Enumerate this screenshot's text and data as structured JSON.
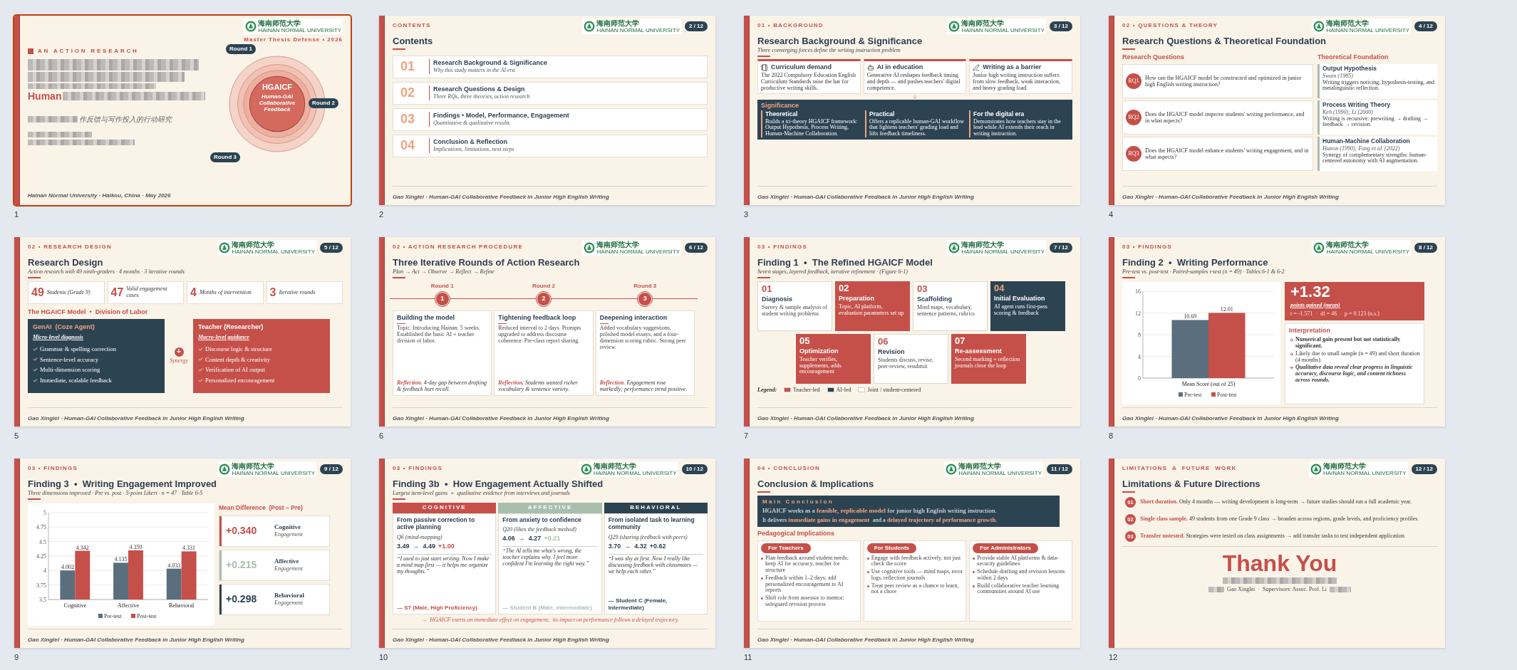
{
  "slides": [
    {
      "number": "1",
      "selected": true,
      "kind": "title",
      "logo": {
        "zh": "海南师范大学",
        "en": "HAINAN NORMAL UNIVERSITY"
      },
      "tagline": "Master Thesis Defense • 2026",
      "eyebrow": "AN ACTION RESEARCH",
      "title_visible": "Human",
      "subtitle_visible": "作反馈与写作投入的行动研究",
      "footer": "Hainan Normal University · Haikou, China · May 2026",
      "diagram": {
        "center": "HGAICF",
        "center_sub": "Human-GAI Collaborative Feedback",
        "rounds": [
          "Round 1",
          "Round 2",
          "Round 3"
        ]
      }
    },
    {
      "number": "2",
      "selected": false,
      "kind": "contents",
      "section": "CONTENTS",
      "page": "2 / 12",
      "logo": {
        "zh": "海南师范大学",
        "en": "HAINAN NORMAL UNIVERSITY"
      },
      "title": "Contents",
      "footer": "Gao Xinglei · Human-GAI Collaborative Feedback in Junior High English Writing",
      "items": [
        {
          "num": "01",
          "title": "Research Background & Significance",
          "sub": "Why this study matters in the AI era"
        },
        {
          "num": "02",
          "title": "Research Questions & Design",
          "sub": "Three RQs, three theories, action research"
        },
        {
          "num": "03",
          "title": "Findings • Model, Performance, Engagement",
          "sub": "Quantitative & qualitative results"
        },
        {
          "num": "04",
          "title": "Conclusion & Reflection",
          "sub": "Implications, limitations, next steps"
        }
      ]
    },
    {
      "number": "3",
      "selected": false,
      "kind": "background",
      "section": "01 • BACKGROUND",
      "page": "3 / 12",
      "logo": {
        "zh": "海南师范大学",
        "en": "HAINAN NORMAL UNIVERSITY"
      },
      "title": "Research Background & Significance",
      "subtitle": "Three converging forces define the writing instruction problem",
      "footer": "Gao Xinglei · Human-GAI Collaborative Feedback in Junior High English Writing",
      "cards": [
        {
          "title": "Curriculum demand",
          "text": "The 2022 Compulsory Education English Curriculum Standards raise the bar for productive writing skills."
        },
        {
          "title": "AI in education",
          "text": "Generative AI reshapes feedback timing and depth — and pushes teachers' digital competence."
        },
        {
          "title": "Writing as a barrier",
          "text": "Junior high writing instruction suffers from slow feedback, weak interaction, and heavy grading load."
        }
      ],
      "significance": {
        "heading": "Significance",
        "columns": [
          {
            "title": "Theoretical",
            "text": "Builds a tri-theory HGAICF framework: Output Hypothesis, Process Writing, Human-Machine Collaboration."
          },
          {
            "title": "Practical",
            "text": "Offers a replicable human-GAI workflow that lightens teachers' grading load and lifts feedback timeliness."
          },
          {
            "title": "For the digital era",
            "text": "Demonstrates how teachers stay in the lead while AI extends their reach in writing instruction."
          }
        ]
      }
    },
    {
      "number": "4",
      "selected": false,
      "kind": "questions",
      "section": "02 • QUESTIONS & THEORY",
      "page": "4 / 12",
      "logo": {
        "zh": "海南师范大学",
        "en": "HAINAN NORMAL UNIVERSITY"
      },
      "title": "Research Questions & Theoretical Foundation",
      "footer": "Gao Xinglei · Human-GAI Collaborative Feedback in Junior High English Writing",
      "rq_heading": "Research Questions",
      "theory_heading": "Theoretical Foundation",
      "questions": [
        {
          "badge": "RQ1",
          "text": "How can the HGAICF model be constructed and optimized in junior high English writing instruction?"
        },
        {
          "badge": "RQ2",
          "text": "Does the HGAICF model improve students' writing performance, and in what aspects?"
        },
        {
          "badge": "RQ3",
          "text": "Does the HGAICF model enhance students' writing engagement, and in what aspects?"
        }
      ],
      "theories": [
        {
          "title": "Output Hypothesis",
          "cite": "Swain (1985)",
          "text": "Writing triggers noticing, hypothesis-testing, and metalinguistic reflection."
        },
        {
          "title": "Process Writing Theory",
          "cite": "Keh (1990); Li (2000)",
          "text": "Writing is recursive: prewriting → drafting → feedback → revision."
        },
        {
          "title": "Human-Machine Collaboration",
          "cite": "Hutton (1990); Fang et al. (2022)",
          "text": "Synergy of complementary strengths: human-centered autonomy with AI augmentation."
        }
      ]
    },
    {
      "number": "5",
      "selected": false,
      "kind": "design",
      "section": "02 • RESEARCH DESIGN",
      "page": "5 / 12",
      "logo": {
        "zh": "海南师范大学",
        "en": "HAINAN NORMAL UNIVERSITY"
      },
      "title": "Research Design",
      "subtitle": "Action research with 49 ninth-graders · 4 months · 3 iterative rounds",
      "footer": "Gao Xinglei · Human-GAI Collaborative Feedback in Junior High English Writing",
      "stats": [
        {
          "value": "49",
          "label": "Students (Grade 9)"
        },
        {
          "value": "47",
          "label": "Valid engagement cases"
        },
        {
          "value": "4",
          "label": "Months of intervention"
        },
        {
          "value": "3",
          "label": "Iterative rounds"
        }
      ],
      "model_heading": "The HGAICF Model  •  Division of Labor",
      "synergy": {
        "symbol": "+",
        "label": "Synergy"
      },
      "panels": [
        {
          "kind": "ai",
          "title": "GenAI  (Coze Agent)",
          "sub": "Micro-level diagnosis",
          "items": [
            "Grammar & spelling correction",
            "Sentence-level accuracy",
            "Multi-dimension scoring",
            "Immediate, scalable feedback"
          ]
        },
        {
          "kind": "teacher",
          "title": "Teacher (Researcher)",
          "sub": "Macro-level guidance",
          "items": [
            "Discourse logic & structure",
            "Content depth & creativity",
            "Verification of AI output",
            "Personalized encouragement"
          ]
        }
      ]
    },
    {
      "number": "6",
      "selected": false,
      "kind": "rounds",
      "section": "02 • ACTION RESEARCH PROCEDURE",
      "page": "6 / 12",
      "logo": {
        "zh": "海南师范大学",
        "en": "HAINAN NORMAL UNIVERSITY"
      },
      "title": "Three Iterative Rounds of Action Research",
      "subtitle": "Plan → Act → Observe → Reflect → Refine",
      "footer": "Gao Xinglei · Human-GAI Collaborative Feedback in Junior High English Writing",
      "rounds": [
        {
          "label": "Round 1",
          "num": "1",
          "title": "Building the model",
          "text": "Topic: Introducing Hainan. 5 weeks. Established the basic AI + teacher division of labor.",
          "reflection": "**Reflection.** 4-day gap between drafting & feedback hurt recall."
        },
        {
          "label": "Round 2",
          "num": "2",
          "title": "Tightening feedback loop",
          "text": "Reduced interval to 2 days. Prompts upgraded to address discourse coherence. Pre-class report sharing.",
          "reflection": "**Reflection.** Students wanted richer vocabulary & sentence variety."
        },
        {
          "label": "Round 3",
          "num": "3",
          "title": "Deepening interaction",
          "text": "Added vocabulary suggestions, polished model essays, and a four-dimension scoring rubric. Strong peer review.",
          "reflection": "**Reflection.** Engagement rose markedly; performance trend positive."
        }
      ]
    },
    {
      "number": "7",
      "selected": false,
      "kind": "stages",
      "section": "03 • FINDINGS",
      "page": "7 / 12",
      "logo": {
        "zh": "海南师范大学",
        "en": "HAINAN NORMAL UNIVERSITY"
      },
      "title": "Finding 1  •  The Refined HGAICF Model",
      "subtitle": "Seven stages, layered feedback, iterative refinement · (Figure 6-1)",
      "footer": "Gao Xinglei · Human-GAI Collaborative Feedback in Junior High English Writing",
      "stages": [
        {
          "kind": "joint",
          "num": "01",
          "title": "Diagnosis",
          "text": "Survey & sample analysis of student writing problems"
        },
        {
          "kind": "teacher",
          "num": "02",
          "title": "Preparation",
          "text": "Topic, AI platform, evaluation parameters set up"
        },
        {
          "kind": "joint",
          "num": "03",
          "title": "Scaffolding",
          "text": "Mind maps, vocabulary, sentence patterns, rubrics"
        },
        {
          "kind": "ai",
          "num": "04",
          "title": "Initial Evaluation",
          "text": "AI agent runs first-pass scoring & feedback"
        },
        {
          "kind": "teacher",
          "num": "05",
          "title": "Optimization",
          "text": "Teacher verifies, supplements, adds encouragement"
        },
        {
          "kind": "joint",
          "num": "06",
          "title": "Revision",
          "text": "Students discuss, revise, peer-review, resubmit"
        },
        {
          "kind": "teacher",
          "num": "07",
          "title": "Re-assessment",
          "text": "Second marking + reflection journals close the loop"
        }
      ],
      "legend_label": "Legend:",
      "legend": [
        {
          "label": "Teacher-led",
          "color": "#c5504a"
        },
        {
          "label": "AI-led",
          "color": "#2c4352"
        },
        {
          "label": "Joint / student-centered",
          "color": "#ffffff"
        }
      ]
    },
    {
      "number": "8",
      "selected": false,
      "kind": "performance",
      "section": "03 • FINDINGS",
      "page": "8 / 12",
      "logo": {
        "zh": "海南师范大学",
        "en": "HAINAN NORMAL UNIVERSITY"
      },
      "title": "Finding 2  •  Writing Performance",
      "subtitle": "Pre-test vs. post-test · Paired-samples t-test (n = 49) · Tables 6-1 & 6-2",
      "footer": "Gao Xinglei · Human-GAI Collaborative Feedback in Junior High English Writing",
      "chart_data": {
        "type": "bar",
        "categories": [
          "Mean Score (out of 25)"
        ],
        "series": [
          {
            "name": "Pre-test",
            "color": "#5a6e7d",
            "values": [
              10.69
            ]
          },
          {
            "name": "Post-test",
            "color": "#c5504a",
            "values": [
              12.01
            ]
          }
        ],
        "ylim": [
          0,
          16
        ],
        "yticks": [
          0,
          4,
          8,
          12,
          16
        ],
        "data_labels": true,
        "grid": true,
        "legend": "bottom"
      },
      "gain": {
        "value": "+1.32",
        "label": "points gained (mean)",
        "stats": "t = -1.571  ·  df = 46  ·  p = 0.123 (n.s.)"
      },
      "interpretation": {
        "heading": "Interpretation",
        "items": [
          {
            "kind": "bold",
            "text": "Numerical gain present but not statistically significant."
          },
          {
            "kind": "plain",
            "text": "Likely due to small sample (n = 49) and short duration (4 months)."
          },
          {
            "kind": "emphasis",
            "text": "Qualitative data reveal clear progress in linguistic accuracy, discourse logic, and content richness across rounds."
          }
        ]
      }
    },
    {
      "number": "9",
      "selected": false,
      "kind": "engagement",
      "section": "03 • FINDINGS",
      "page": "9 / 12",
      "logo": {
        "zh": "海南师范大学",
        "en": "HAINAN NORMAL UNIVERSITY"
      },
      "title": "Finding 3  •  Writing Engagement Improved",
      "subtitle": "Three dimensions improved · Pre vs. post · 5-point Likert · n = 47 · Table 6-5",
      "footer": "Gao Xinglei · Human-GAI Collaborative Feedback in Junior High English Writing",
      "chart_data": {
        "type": "bar",
        "categories": [
          "Cognitive",
          "Affective",
          "Behavioral"
        ],
        "series": [
          {
            "name": "Pre-test",
            "color": "#5a6e7d",
            "values": [
              4.002,
              4.135,
              4.033
            ]
          },
          {
            "name": "Post-test",
            "color": "#c5504a",
            "values": [
              4.342,
              4.35,
              4.331
            ]
          }
        ],
        "ylim": [
          3.5,
          5
        ],
        "yticks": [
          3.5,
          3.75,
          4,
          4.25,
          4.5,
          4.75,
          5
        ],
        "value_labels": [
          [
            "4.002",
            "4.135",
            "4.033"
          ],
          [
            "4.342",
            "4.350",
            "4.331"
          ]
        ],
        "grid": true,
        "legend": "bottom"
      },
      "diff_heading": "Mean Difference  (Post − Pre)",
      "diffs": [
        {
          "value": "+0.340",
          "label": "Cognitive",
          "sub": "Engagement",
          "color": "#c5504a"
        },
        {
          "value": "+0.215",
          "label": "Affective",
          "sub": "Engagement",
          "color": "#a8bfae"
        },
        {
          "value": "+0.298",
          "label": "Behavioral",
          "sub": "Engagement",
          "color": "#2c4352"
        }
      ]
    },
    {
      "number": "10",
      "selected": false,
      "kind": "shifts",
      "section": "03 • FINDINGS",
      "page": "10 / 12",
      "logo": {
        "zh": "海南师范大学",
        "en": "HAINAN NORMAL UNIVERSITY"
      },
      "title": "Finding 3b  •  How Engagement Actually Shifted",
      "subtitle": "Largest item-level gains  +  qualitative evidence from interviews and journals",
      "footer": "Gao Xinglei · Human-GAI Collaborative Feedback in Junior High English Writing",
      "columns": [
        {
          "header": "COGNITIVE",
          "color": "#c5504a",
          "title": "From passive correction to active planning",
          "item": "Q6 (mind-mapping)",
          "scores": "3.49  →  4.49",
          "delta": "+1.00",
          "quote": "“I used to just start writing. Now I make a mind map first — it helps me organize my thoughts.”",
          "source": "— S7 (Male, High Proficiency)"
        },
        {
          "header": "AFFECTIVE",
          "color": "#a8bfae",
          "title": "From anxiety to confidence",
          "item": "Q20 (likes the feedback method)",
          "scores": "4.06  →  4.27",
          "delta": "+0.21",
          "quote": "“The AI tells me what's wrong, the teacher explains why. I feel more confident I'm learning the right way.”",
          "source": "— Student B (Male, Intermediate)"
        },
        {
          "header": "BEHAVIORAL",
          "color": "#2c4352",
          "title": "From isolated task to learning community",
          "item": "Q29 (sharing feedback with peers)",
          "scores": "3.70  →  4.32",
          "delta": "+0.62",
          "quote": "“I was shy at first. Now I really like discussing feedback with classmates — we help each other.”",
          "source": "— Student C (Female, Intermediate)"
        }
      ],
      "note": "→  HGAICF exerts an immediate effect on engagement;  its impact on performance follows a delayed trajectory."
    },
    {
      "number": "11",
      "selected": false,
      "kind": "conclusion",
      "section": "04 • CONCLUSION",
      "page": "11 / 12",
      "logo": {
        "zh": "海南师范大学",
        "en": "HAINAN NORMAL UNIVERSITY"
      },
      "title": "Conclusion & Implications",
      "footer": "Gao Xinglei · Human-GAI Collaborative Feedback in Junior High English Writing",
      "main": {
        "heading": "Main Conclusion",
        "line1": "HGAICF works as a **feasible, replicable model** for junior high English writing instruction.",
        "line2": "It delivers **immediate gains in engagement**  and a **delayed trajectory of performance growth**."
      },
      "implications_heading": "Pedagogical Implications",
      "groups": [
        {
          "label": "For Teachers",
          "items": [
            "Plan feedback around student needs; keep AI for accuracy, teacher for structure",
            "Feedback within 1–2 days; add personalized encouragement to AI reports",
            "Shift role from assessor to mentor; safeguard revision process"
          ]
        },
        {
          "label": "For Students",
          "items": [
            "Engage with feedback actively, not just check the score",
            "Use cognitive tools — mind maps, error logs, reflection journals",
            "Treat peer review as a chance to learn, not a chore"
          ]
        },
        {
          "label": "For Administrators",
          "items": [
            "Provide stable AI platforms & data-security guidelines",
            "Schedule drafting and revision lessons within 2 days",
            "Build collaborative teacher learning communities around AI use"
          ]
        }
      ]
    },
    {
      "number": "12",
      "selected": false,
      "kind": "limitations",
      "section": "LIMITATIONS  &  FUTURE  WORK",
      "page": "12 / 12",
      "logo": {
        "zh": "海南师范大学",
        "en": "HAINAN NORMAL UNIVERSITY"
      },
      "title": "Limitations & Future Directions",
      "items": [
        {
          "num": "01",
          "text": "**Short duration.**  Only 4 months — writing development is long-term  →  future studies should run a full academic year."
        },
        {
          "num": "02",
          "text": "**Single class sample.**  49 students from one Grade 9 class  →  broaden across regions, grade levels, and proficiency profiles."
        },
        {
          "num": "03",
          "text": "**Transfer untested.**  Strategies were tested on class assignments  →  add transfer tasks to test independent application."
        }
      ],
      "thanks": "Thank You",
      "credits_visible": "Gao Xinglei  ·  Supervisors: Assoc. Prof. Li"
    }
  ]
}
